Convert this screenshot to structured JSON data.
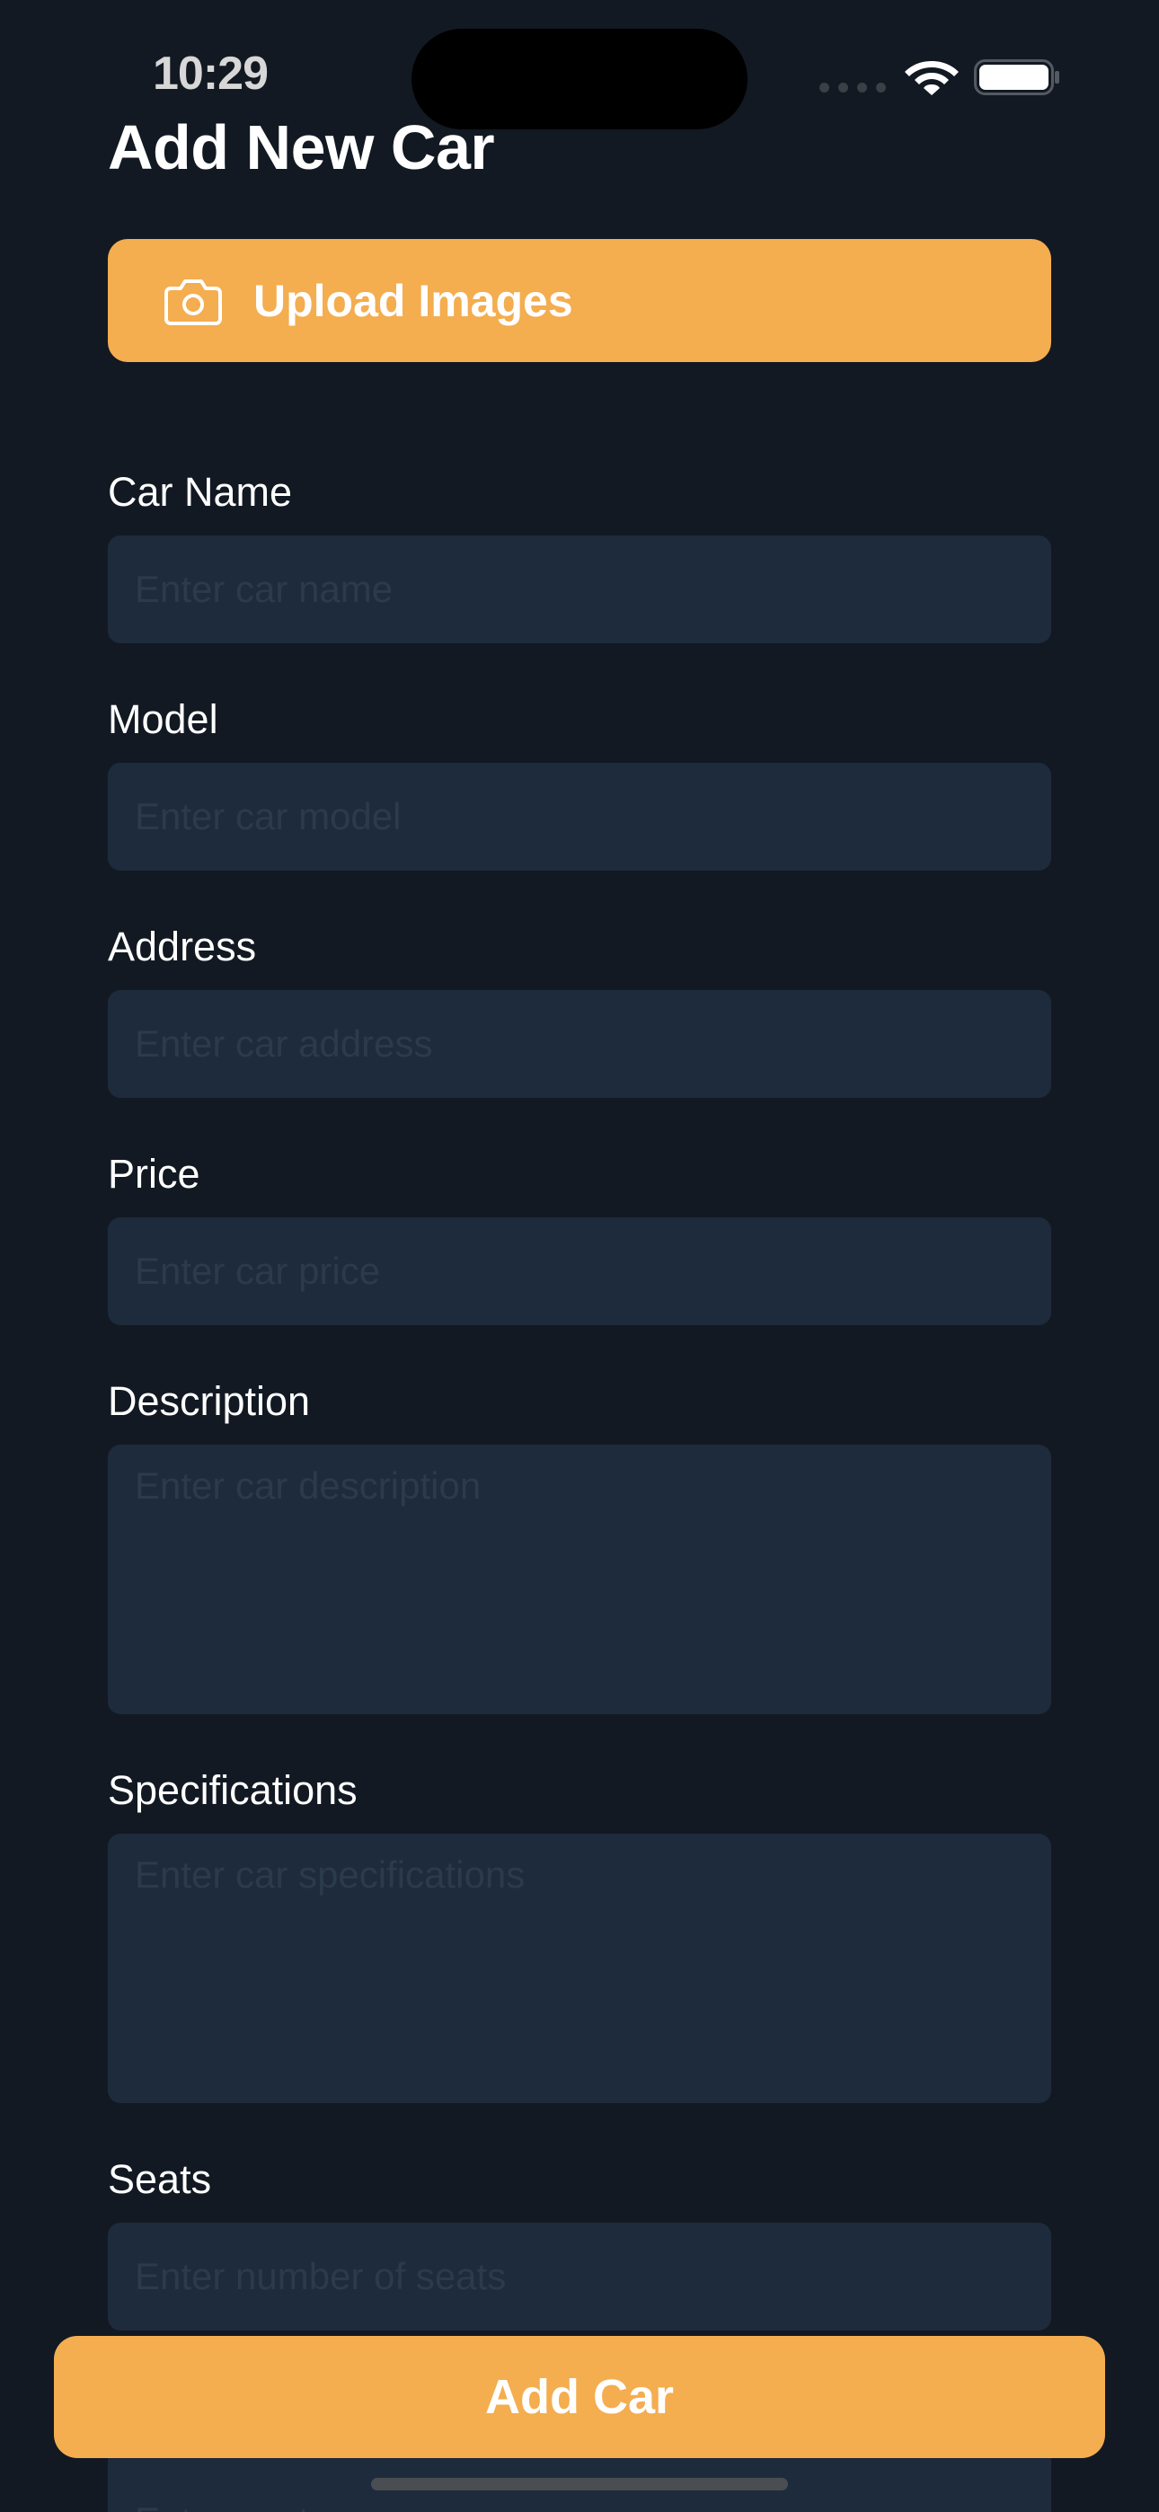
{
  "status_bar": {
    "time": "10:29",
    "wifi_icon": "wifi-icon",
    "battery_icon": "battery-icon"
  },
  "page": {
    "title": "Add New Car"
  },
  "upload": {
    "icon": "camera-icon",
    "label": "Upload Images"
  },
  "fields": {
    "car_name": {
      "label": "Car Name",
      "placeholder": "Enter car name",
      "value": ""
    },
    "model": {
      "label": "Model",
      "placeholder": "Enter car model",
      "value": ""
    },
    "address": {
      "label": "Address",
      "placeholder": "Enter car address",
      "value": ""
    },
    "price": {
      "label": "Price",
      "placeholder": "Enter car price",
      "value": ""
    },
    "description": {
      "label": "Description",
      "placeholder": "Enter car description",
      "value": ""
    },
    "specifications": {
      "label": "Specifications",
      "placeholder": "Enter car specifications",
      "value": ""
    },
    "seats": {
      "label": "Seats",
      "placeholder": "Enter number of seats",
      "value": ""
    },
    "car_type": {
      "placeholder": "Enter car type",
      "value": ""
    }
  },
  "submit": {
    "label": "Add Car"
  },
  "colors": {
    "background": "#121922",
    "input_background": "#1e2b3c",
    "accent": "#f4ad4f",
    "text": "#ffffff"
  }
}
